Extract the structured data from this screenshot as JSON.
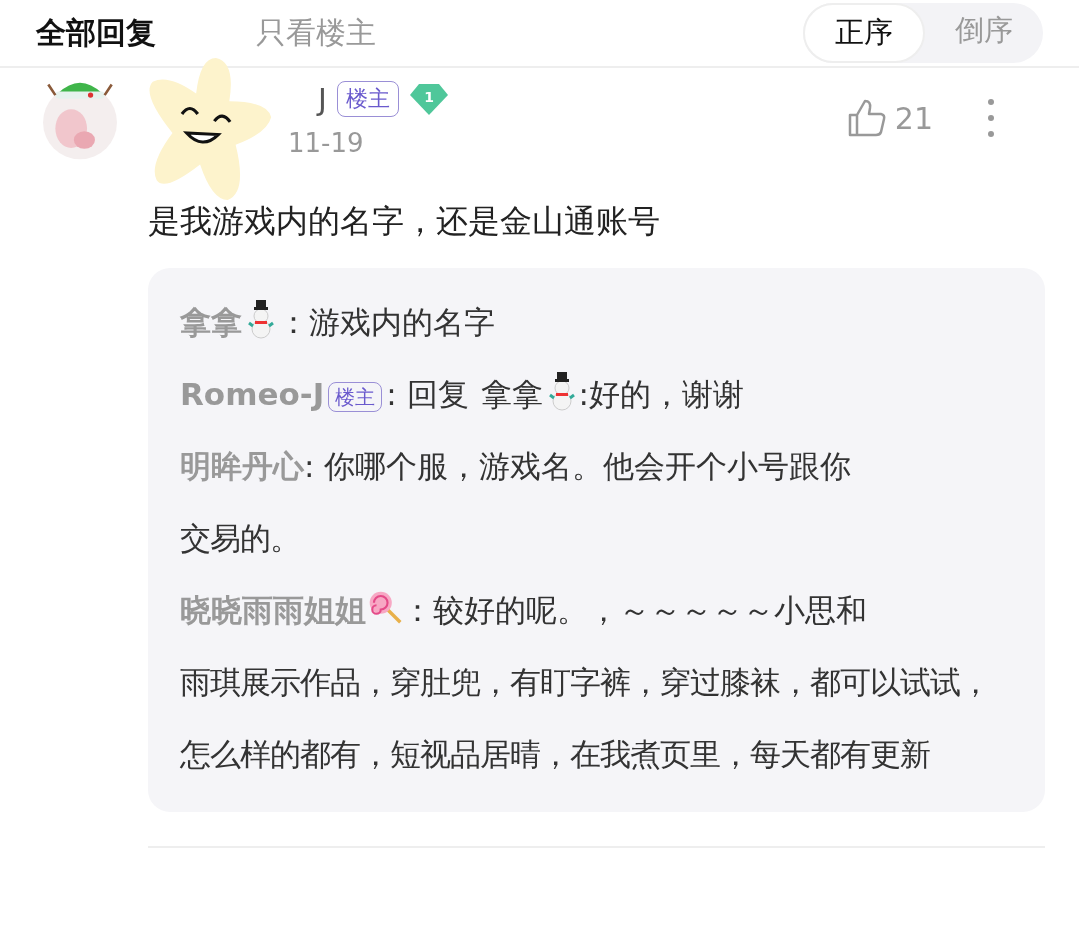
{
  "tabs": [
    {
      "label": "全部回复",
      "selected": true
    },
    {
      "label": "只看楼主",
      "selected": false
    }
  ],
  "sort": [
    {
      "label": "正序",
      "selected": true
    },
    {
      "label": "倒序",
      "selected": false
    }
  ],
  "comment": {
    "author": "J",
    "badge": "楼主",
    "rank": "1",
    "date": "11-19",
    "likes": "21",
    "text": "是我游戏内的名字，还是金山通账号",
    "replies": [
      {
        "parts": [
          {
            "kind": "name",
            "text": "拿拿"
          },
          {
            "kind": "snowman"
          },
          {
            "kind": "text",
            "text": "：游戏内的名字"
          }
        ]
      },
      {
        "parts": [
          {
            "kind": "name",
            "text": "Romeo-J"
          },
          {
            "kind": "badge",
            "text": "楼主"
          },
          {
            "kind": "text",
            "text": ": 回复"
          },
          {
            "kind": "mention",
            "text": "拿拿"
          },
          {
            "kind": "snowman"
          },
          {
            "kind": "text",
            "text": ":好的，谢谢"
          }
        ]
      },
      {
        "parts": [
          {
            "kind": "name",
            "text": "明眸丹心"
          },
          {
            "kind": "text",
            "text": ": 你哪个服，游戏名。他会开个小号跟你"
          },
          {
            "kind": "more",
            "text": "交易的。"
          }
        ]
      },
      {
        "parts": [
          {
            "kind": "name",
            "text": "晓晓雨雨姐姐"
          },
          {
            "kind": "lollipop"
          },
          {
            "kind": "text",
            "text": "：较好的呢。，～～～～～小思和"
          },
          {
            "kind": "more",
            "text": "雨琪展示作品，穿肚兜，有盯字裤，穿过膝袜，都可以试试，怎么样的都有，短视品居晴，在我煮页里，每天都有更新"
          }
        ]
      }
    ]
  }
}
